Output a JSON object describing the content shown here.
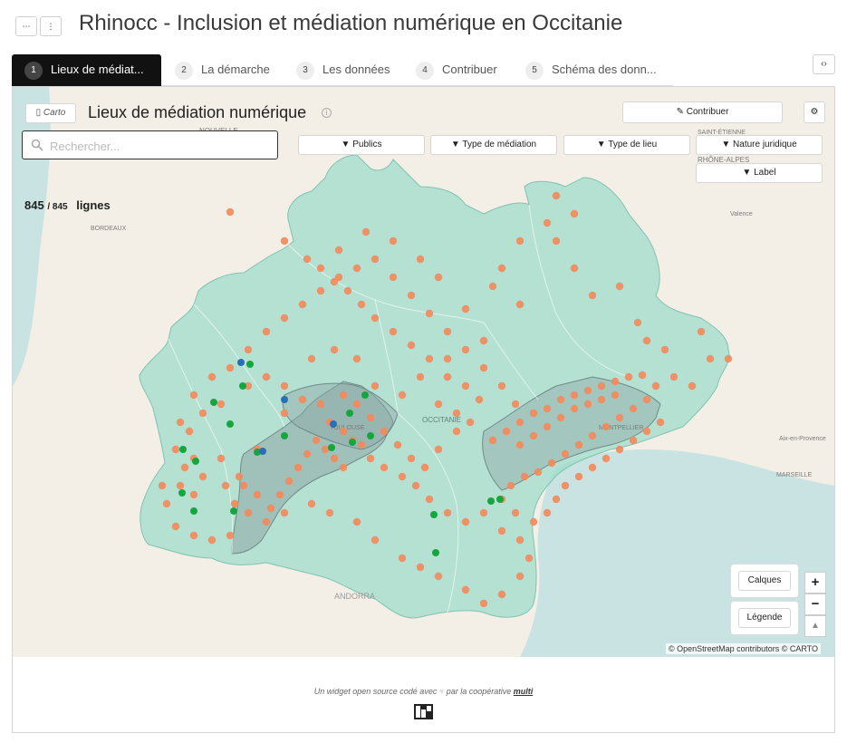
{
  "header": {
    "title": "Rhinocc - Inclusion et médiation numérique en Occitanie",
    "mini_btn_1": "⋯",
    "mini_btn_2": "⋮",
    "code_toggle": "‹›"
  },
  "tabs": [
    {
      "num": "1",
      "label": "Lieux de médiat..."
    },
    {
      "num": "2",
      "label": "La démarche"
    },
    {
      "num": "3",
      "label": "Les données"
    },
    {
      "num": "4",
      "label": "Contribuer"
    },
    {
      "num": "5",
      "label": "Schéma des donn..."
    }
  ],
  "widget": {
    "carto_label": "Carto",
    "title": "Lieux de médiation numérique",
    "info_icon": "ⓘ",
    "contribute_label": "Contribuer",
    "settings_icon": "gear-icon",
    "search_placeholder": "Rechercher...",
    "filters": [
      "Publics",
      "Type de médiation",
      "Type de lieu",
      "Nature juridique",
      "Label"
    ],
    "count_shown": "845",
    "count_total": "845",
    "count_unit": "lignes"
  },
  "map": {
    "place_labels": {
      "bordeaux": "BORDEAUX",
      "occitanie": "OCCITANIE",
      "andorra": "ANDORRA",
      "montpellier": "MONTPELLIER",
      "toulouse": "TOULOUSE",
      "marseille": "MARSEILLE",
      "aix": "Aix-en-Provence",
      "valence": "Valence",
      "saint_etienne": "SAINT-ÉTIENNE",
      "rhone_alpes": "RHÔNE-ALPES",
      "nouvelle": "NOUVELLE"
    },
    "layers_label": "Calques",
    "legend_label": "Légende",
    "zoom_in": "+",
    "zoom_out": "−",
    "north": "▲",
    "attribution": "© OpenStreetMap contributors © CARTO",
    "colors": {
      "water": "#c9e3e3",
      "land": "#f3efe6",
      "region": "#9fdccb",
      "department_highlight": "#8fa8a6",
      "marker_orange": "#f28a5c",
      "marker_green": "#17a540",
      "marker_blue": "#2a6fb5"
    }
  },
  "footer": {
    "text_before": "Un widget open source codé avec",
    "heart": "♥",
    "text_middle": "par la coopérative",
    "brand": "multi"
  }
}
